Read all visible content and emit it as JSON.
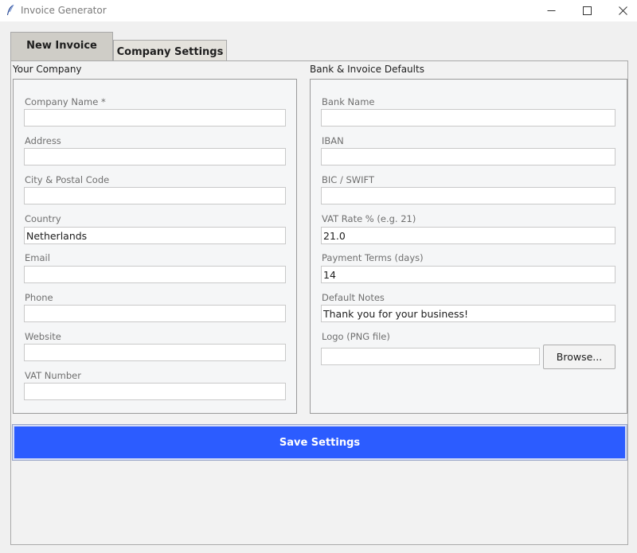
{
  "window": {
    "title": "Invoice Generator",
    "controls": [
      "minimize-icon",
      "maximize-icon",
      "close-icon"
    ]
  },
  "tabs": [
    {
      "label": "New Invoice",
      "selected": false
    },
    {
      "label": "Company Settings",
      "selected": true
    }
  ],
  "company": {
    "section_title": "Your Company",
    "fields": [
      {
        "label": "Company Name *",
        "value": ""
      },
      {
        "label": "Address",
        "value": ""
      },
      {
        "label": "City & Postal Code",
        "value": ""
      },
      {
        "label": "Country",
        "value": "Netherlands"
      },
      {
        "label": "Email",
        "value": ""
      },
      {
        "label": "Phone",
        "value": ""
      },
      {
        "label": "Website",
        "value": ""
      },
      {
        "label": "VAT Number",
        "value": ""
      }
    ]
  },
  "bank": {
    "section_title": "Bank & Invoice Defaults",
    "fields": [
      {
        "label": "Bank Name",
        "value": ""
      },
      {
        "label": "IBAN",
        "value": ""
      },
      {
        "label": "BIC / SWIFT",
        "value": ""
      },
      {
        "label": "VAT Rate % (e.g. 21)",
        "value": "21.0"
      },
      {
        "label": "Payment Terms (days)",
        "value": "14"
      },
      {
        "label": "Default Notes",
        "value": "Thank you for your business!"
      },
      {
        "label": "Logo (PNG file)",
        "value": ""
      }
    ],
    "browse_label": "Browse..."
  },
  "save_label": "Save Settings",
  "colors": {
    "accent": "#2c5cff",
    "tab_active": "#e4e2dc",
    "tab_inactive": "#cfcdc7"
  }
}
